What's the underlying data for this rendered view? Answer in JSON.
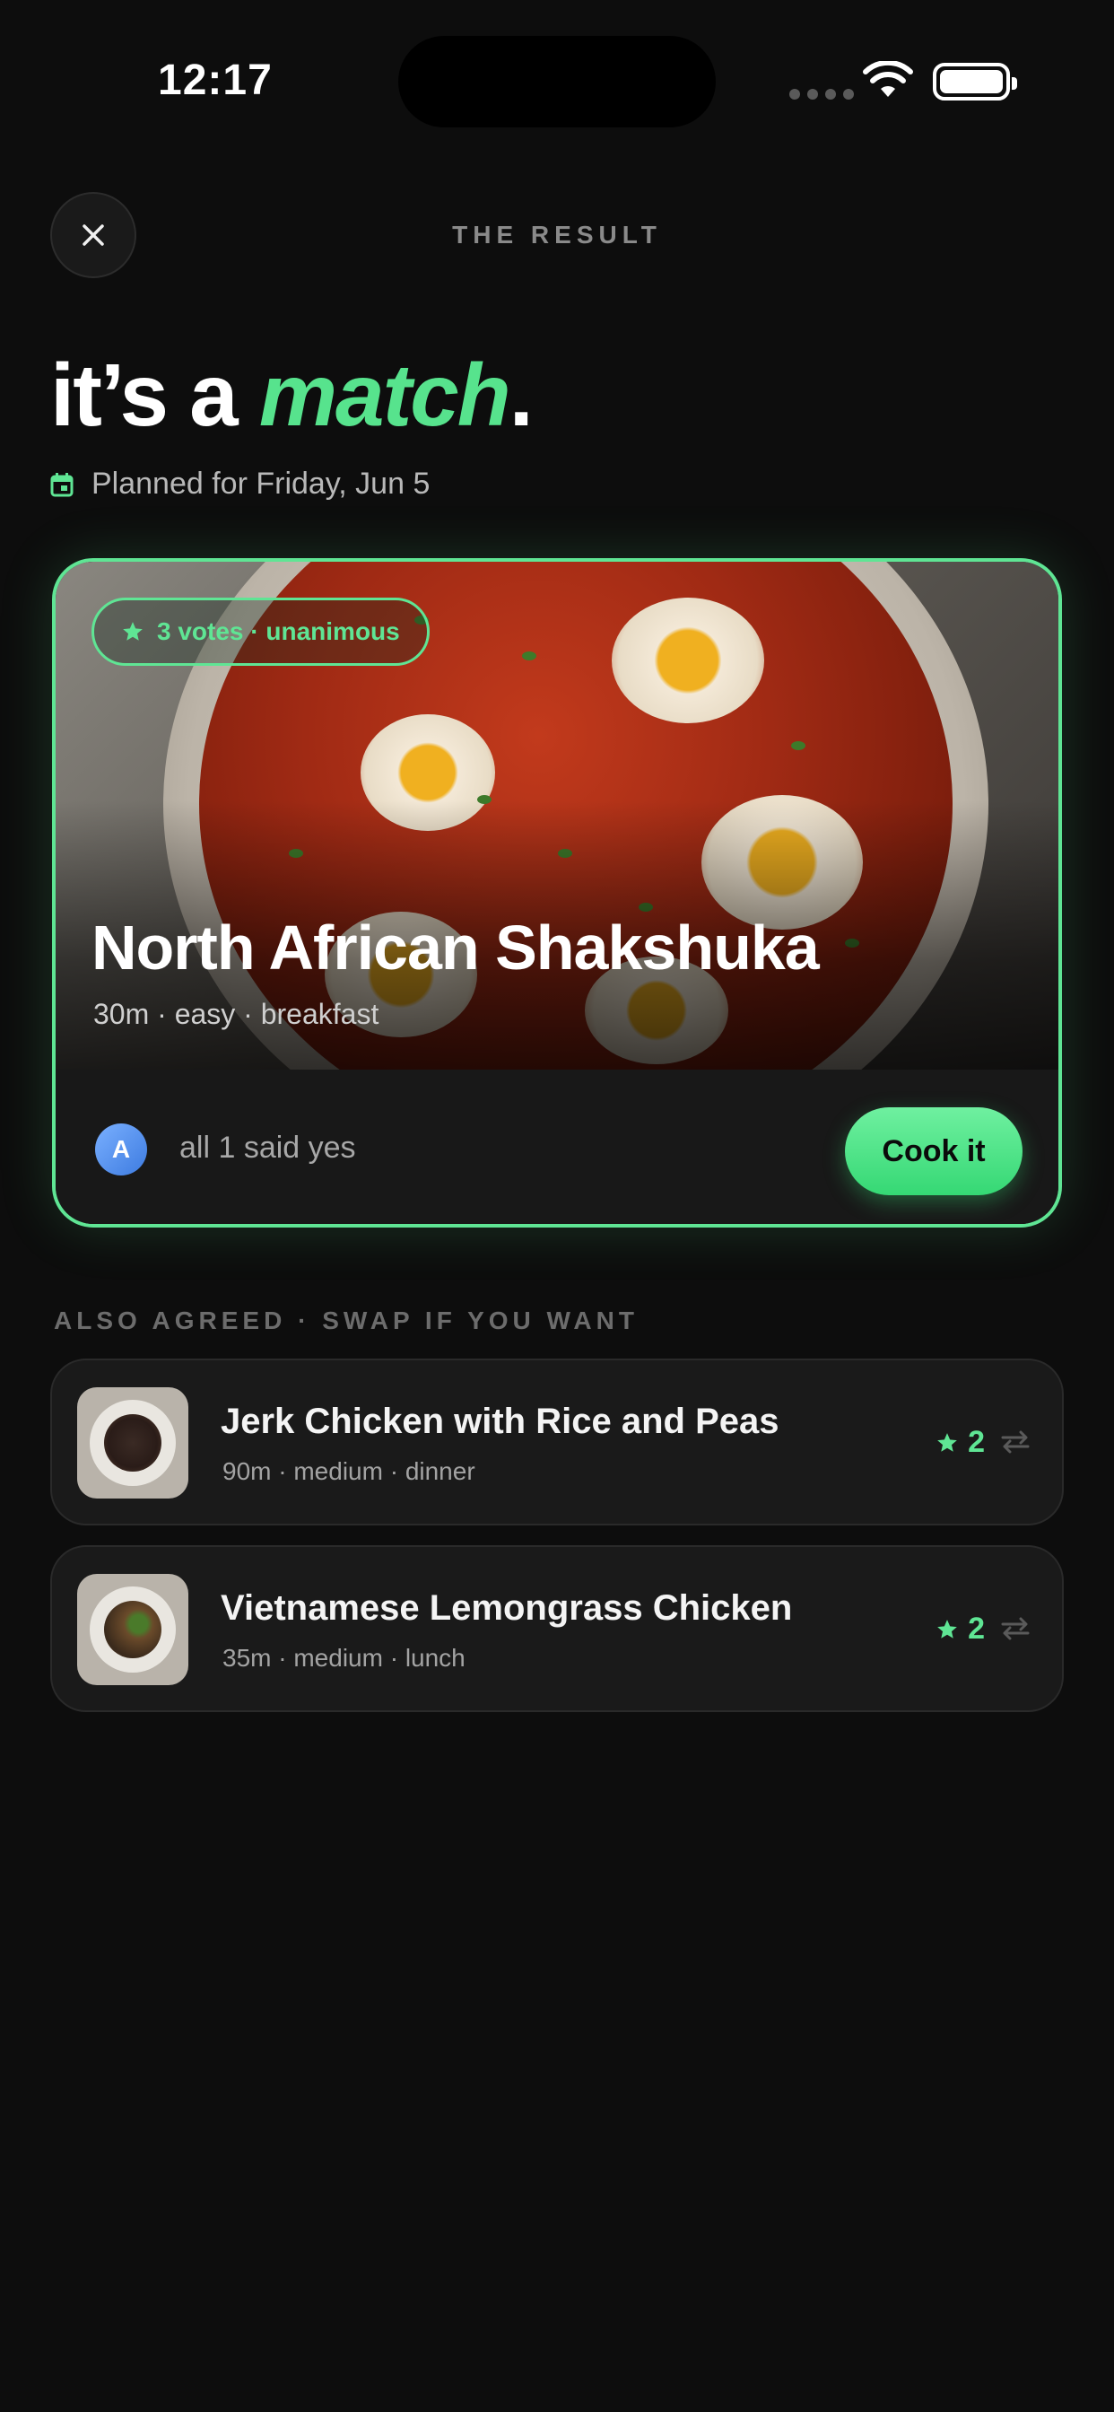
{
  "status_bar": {
    "time": "12:17"
  },
  "header": {
    "title": "THE RESULT"
  },
  "headline": {
    "prefix": "it’s a ",
    "accent": "match",
    "suffix": "."
  },
  "planned": {
    "text": "Planned for Friday, Jun 5"
  },
  "main_card": {
    "votes_pill": "3 votes · unanimous",
    "title": "North African Shakshuka",
    "meta": "30m · easy · breakfast",
    "avatar_initial": "A",
    "said_yes": "all 1 said yes",
    "cook_label": "Cook it"
  },
  "also_agreed": {
    "label": "ALSO AGREED · SWAP IF YOU WANT",
    "items": [
      {
        "title": "Jerk Chicken with Rice and Peas",
        "meta": "90m · medium · dinner",
        "votes": "2"
      },
      {
        "title": "Vietnamese Lemongrass Chicken",
        "meta": "35m · medium · lunch",
        "votes": "2"
      }
    ]
  },
  "colors": {
    "accent": "#5fe594",
    "background": "#0d0d0d",
    "card": "#1a1a1a"
  },
  "icons": [
    "close-icon",
    "calendar-icon",
    "star-icon",
    "swap-icon",
    "wifi-icon",
    "battery-icon"
  ]
}
